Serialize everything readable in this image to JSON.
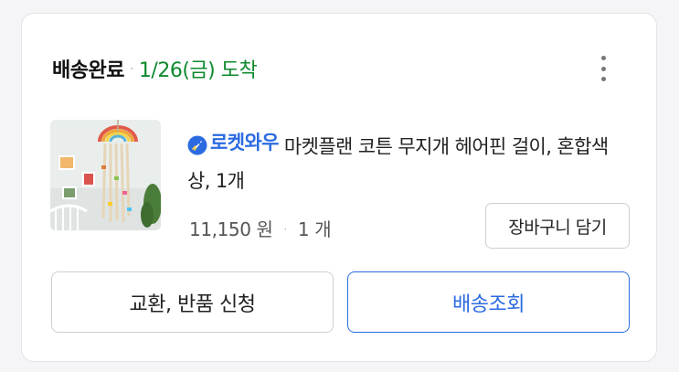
{
  "order": {
    "status_label": "배송완료",
    "separator": "·",
    "arrival": "1/26(금) 도착",
    "status_color": "#0e8a2e"
  },
  "more_menu": {
    "icon": "more-vertical-icon"
  },
  "product": {
    "image_alt": "rainbow hair clip holder",
    "badge_icon": "rocket-icon",
    "badge_label": "로켓와우",
    "title": "마켓플랜 코튼 무지개 헤어핀 걸이, 혼합색상, 1개",
    "price": "11,150 원",
    "separator": "·",
    "quantity": "1 개",
    "badge_color": "#2b6be2"
  },
  "buttons": {
    "add_to_cart": "장바구니 담기",
    "exchange_return": "교환, 반품 신청",
    "track_delivery": "배송조회"
  }
}
